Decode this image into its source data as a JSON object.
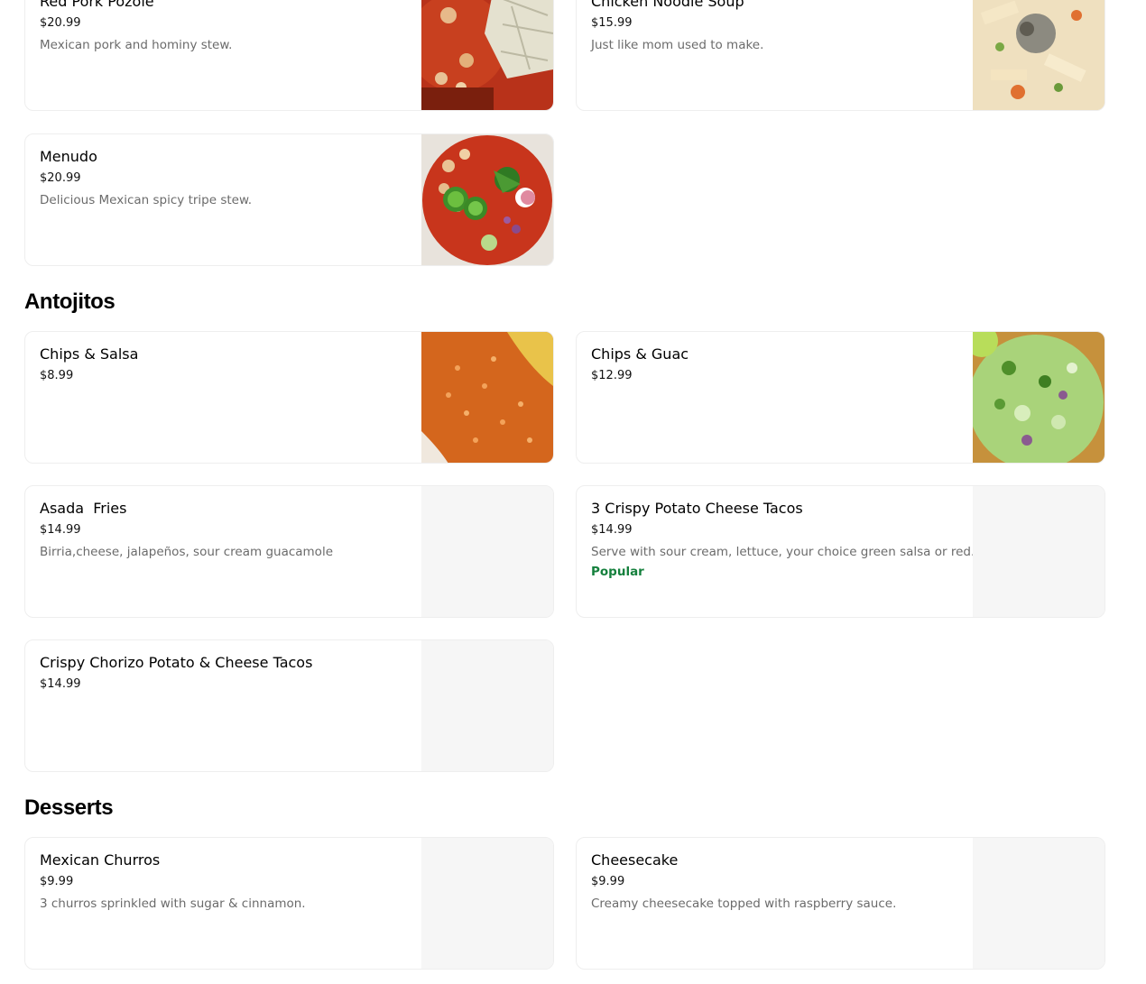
{
  "colors": {
    "popular": "#15803d",
    "placeholder": "#f6f6f6"
  },
  "sections": [
    {
      "title": "",
      "items": [
        {
          "name": "Red Pork Pozole",
          "price": "$20.99",
          "description": "Mexican pork and hominy stew.",
          "badge": "",
          "photo": "red-pozole-photo"
        },
        {
          "name": "Chicken Noodle Soup",
          "price": "$15.99",
          "description": "Just like mom used to make.",
          "badge": "",
          "photo": "chicken-noodle-soup-photo"
        },
        {
          "name": "Menudo",
          "price": "$20.99",
          "description": "Delicious Mexican spicy tripe stew.",
          "badge": "",
          "photo": "menudo-photo"
        }
      ]
    },
    {
      "title": "Antojitos",
      "items": [
        {
          "name": "Chips & Salsa",
          "price": "$8.99",
          "description": "",
          "badge": "",
          "photo": "salsa-photo"
        },
        {
          "name": "Chips & Guac",
          "price": "$12.99",
          "description": "",
          "badge": "",
          "photo": "guacamole-photo"
        },
        {
          "name": "Asada  Fries",
          "price": "$14.99",
          "description": "Birria,cheese, jalapeños, sour cream guacamole",
          "badge": "",
          "photo": ""
        },
        {
          "name": "3 Crispy Potato Cheese Tacos",
          "price": "$14.99",
          "description": "Serve with sour cream, lettuce, your choice green salsa or red.",
          "badge": "Popular",
          "photo": ""
        },
        {
          "name": "Crispy Chorizo Potato & Cheese Tacos",
          "price": "$14.99",
          "description": "",
          "badge": "",
          "photo": ""
        }
      ]
    },
    {
      "title": "Desserts",
      "items": [
        {
          "name": "Mexican Churros",
          "price": "$9.99",
          "description": "3 churros sprinkled with sugar & cinnamon.",
          "badge": "",
          "photo": ""
        },
        {
          "name": "Cheesecake",
          "price": "$9.99",
          "description": "Creamy cheesecake topped with raspberry sauce.",
          "badge": "",
          "photo": ""
        }
      ]
    }
  ]
}
